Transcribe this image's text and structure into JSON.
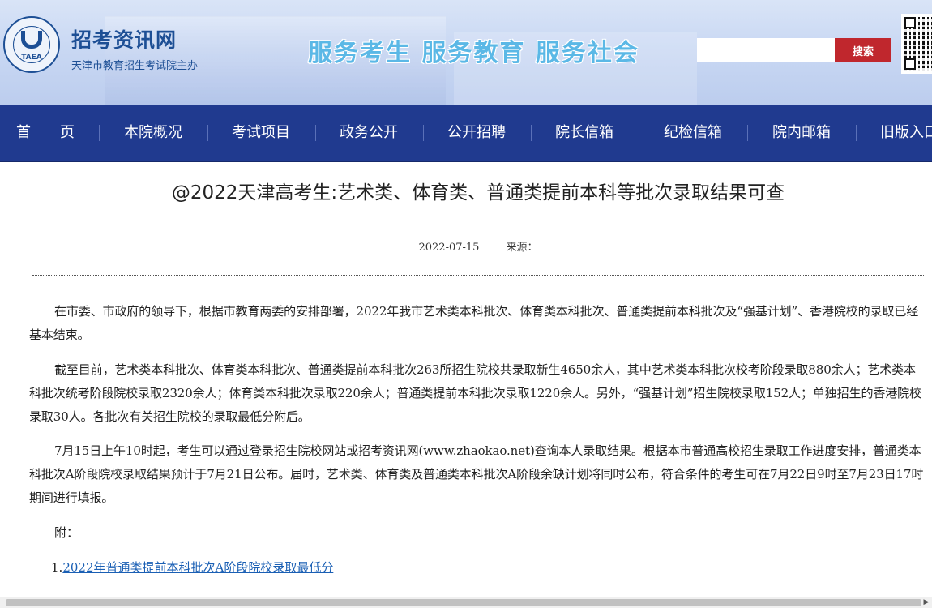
{
  "header": {
    "logo_abbr": "TAEA",
    "site_name": "招考资讯网",
    "site_sub": "天津市教育招生考试院主办",
    "slogan": "服务考生  服务教育  服务社会",
    "search": {
      "placeholder": "",
      "button_label": "搜索"
    }
  },
  "nav": {
    "items": [
      {
        "label": "首　　页"
      },
      {
        "label": "本院概况"
      },
      {
        "label": "考试项目"
      },
      {
        "label": "政务公开"
      },
      {
        "label": "公开招聘"
      },
      {
        "label": "院长信箱"
      },
      {
        "label": "纪检信箱"
      },
      {
        "label": "院内邮箱"
      },
      {
        "label": "旧版入口"
      }
    ]
  },
  "article": {
    "title": "@2022天津高考生:艺术类、体育类、普通类提前本科等批次录取结果可查",
    "date": "2022-07-15",
    "source_label": "来源：",
    "paragraphs": [
      "在市委、市政府的领导下，根据市教育两委的安排部署，2022年我市艺术类本科批次、体育类本科批次、普通类提前本科批次及“强基计划”、香港院校的录取已经基本结束。",
      "截至目前，艺术类本科批次、体育类本科批次、普通类提前本科批次263所招生院校共录取新生4650余人，其中艺术类本科批次校考阶段录取880余人；艺术类本科批次统考阶段院校录取2320余人；体育类本科批次录取220余人；普通类提前本科批次录取1220余人。另外，“强基计划”招生院校录取152人；单独招生的香港院校录取30人。各批次有关招生院校的录取最低分附后。",
      "7月15日上午10时起，考生可以通过登录招生院校网站或招考资讯网(www.zhaokao.net)查询本人录取结果。根据本市普通高校招生录取工作进度安排，普通类本科批次A阶段院校录取结果预计于7月21日公布。届时，艺术类、体育类及普通类本科批次A阶段余缺计划将同时公布，符合条件的考生可在7月22日9时至7月23日17时期间进行填报。"
    ],
    "attachment_label": "附：",
    "attachments": [
      {
        "index": "1.",
        "title": "2022年普通类提前本科批次A阶段院校录取最低分"
      }
    ]
  },
  "colors": {
    "nav_bg": "#203a8f",
    "brand_blue": "#1d4f95",
    "search_button": "#c0272d",
    "slogan": "#5bb8e6",
    "link": "#1a5fb4"
  },
  "icons": {
    "logo": "taea-logo-icon",
    "qr": "qr-code-icon",
    "scroll_right": "scroll-right-arrow-icon"
  }
}
